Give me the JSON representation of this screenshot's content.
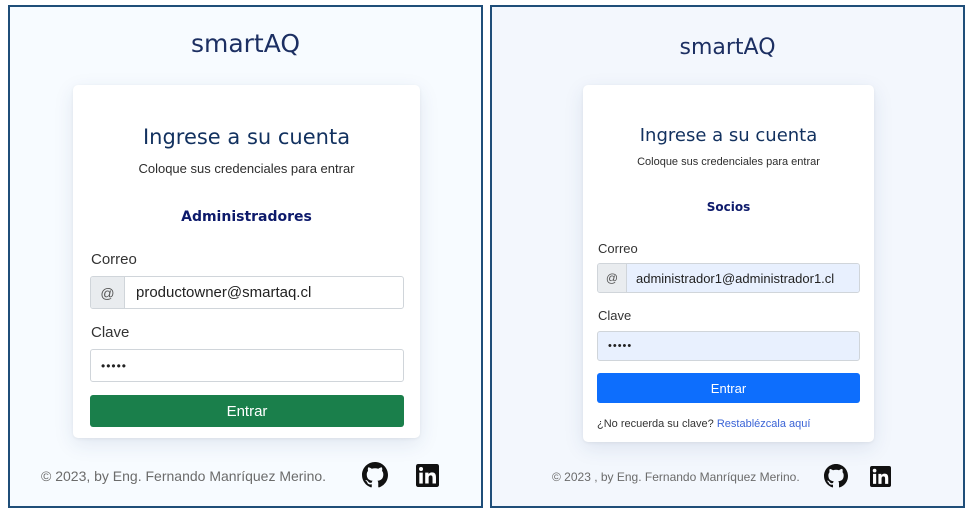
{
  "admin_panel": {
    "brand": "smartAQ",
    "title": "Ingrese a su cuenta",
    "subtitle": "Coloque sus credenciales para entrar",
    "role": "Administradores",
    "email_label": "Correo",
    "email_addon": "@",
    "email_value": "productowner@smartaq.cl",
    "password_label": "Clave",
    "password_value": "•••••",
    "submit_label": "Entrar",
    "footer": "© 2023, by Eng. Fernando Manríquez Merino.",
    "icons": [
      "github-icon",
      "linkedin-icon"
    ],
    "button_color": "#1a7f4b"
  },
  "socios_panel": {
    "brand": "smartAQ",
    "title": "Ingrese a su cuenta",
    "subtitle": "Coloque sus credenciales para entrar",
    "role": "Socios",
    "email_label": "Correo",
    "email_addon": "@",
    "email_value": "administrador1@administrador1.cl",
    "password_label": "Clave",
    "password_value": "•••••",
    "submit_label": "Entrar",
    "forgot_text": "¿No recuerda su clave?",
    "forgot_link": "Restablézcala aquí",
    "footer": "© 2023 , by Eng. Fernando Manríquez Merino.",
    "icons": [
      "github-icon",
      "linkedin-icon"
    ],
    "button_color": "#0d6efd"
  },
  "colors": {
    "brand_text": "#1c2f62",
    "border": "#1f4e79",
    "link": "#3a63d6",
    "autofill_bg": "#e8f0fe"
  }
}
